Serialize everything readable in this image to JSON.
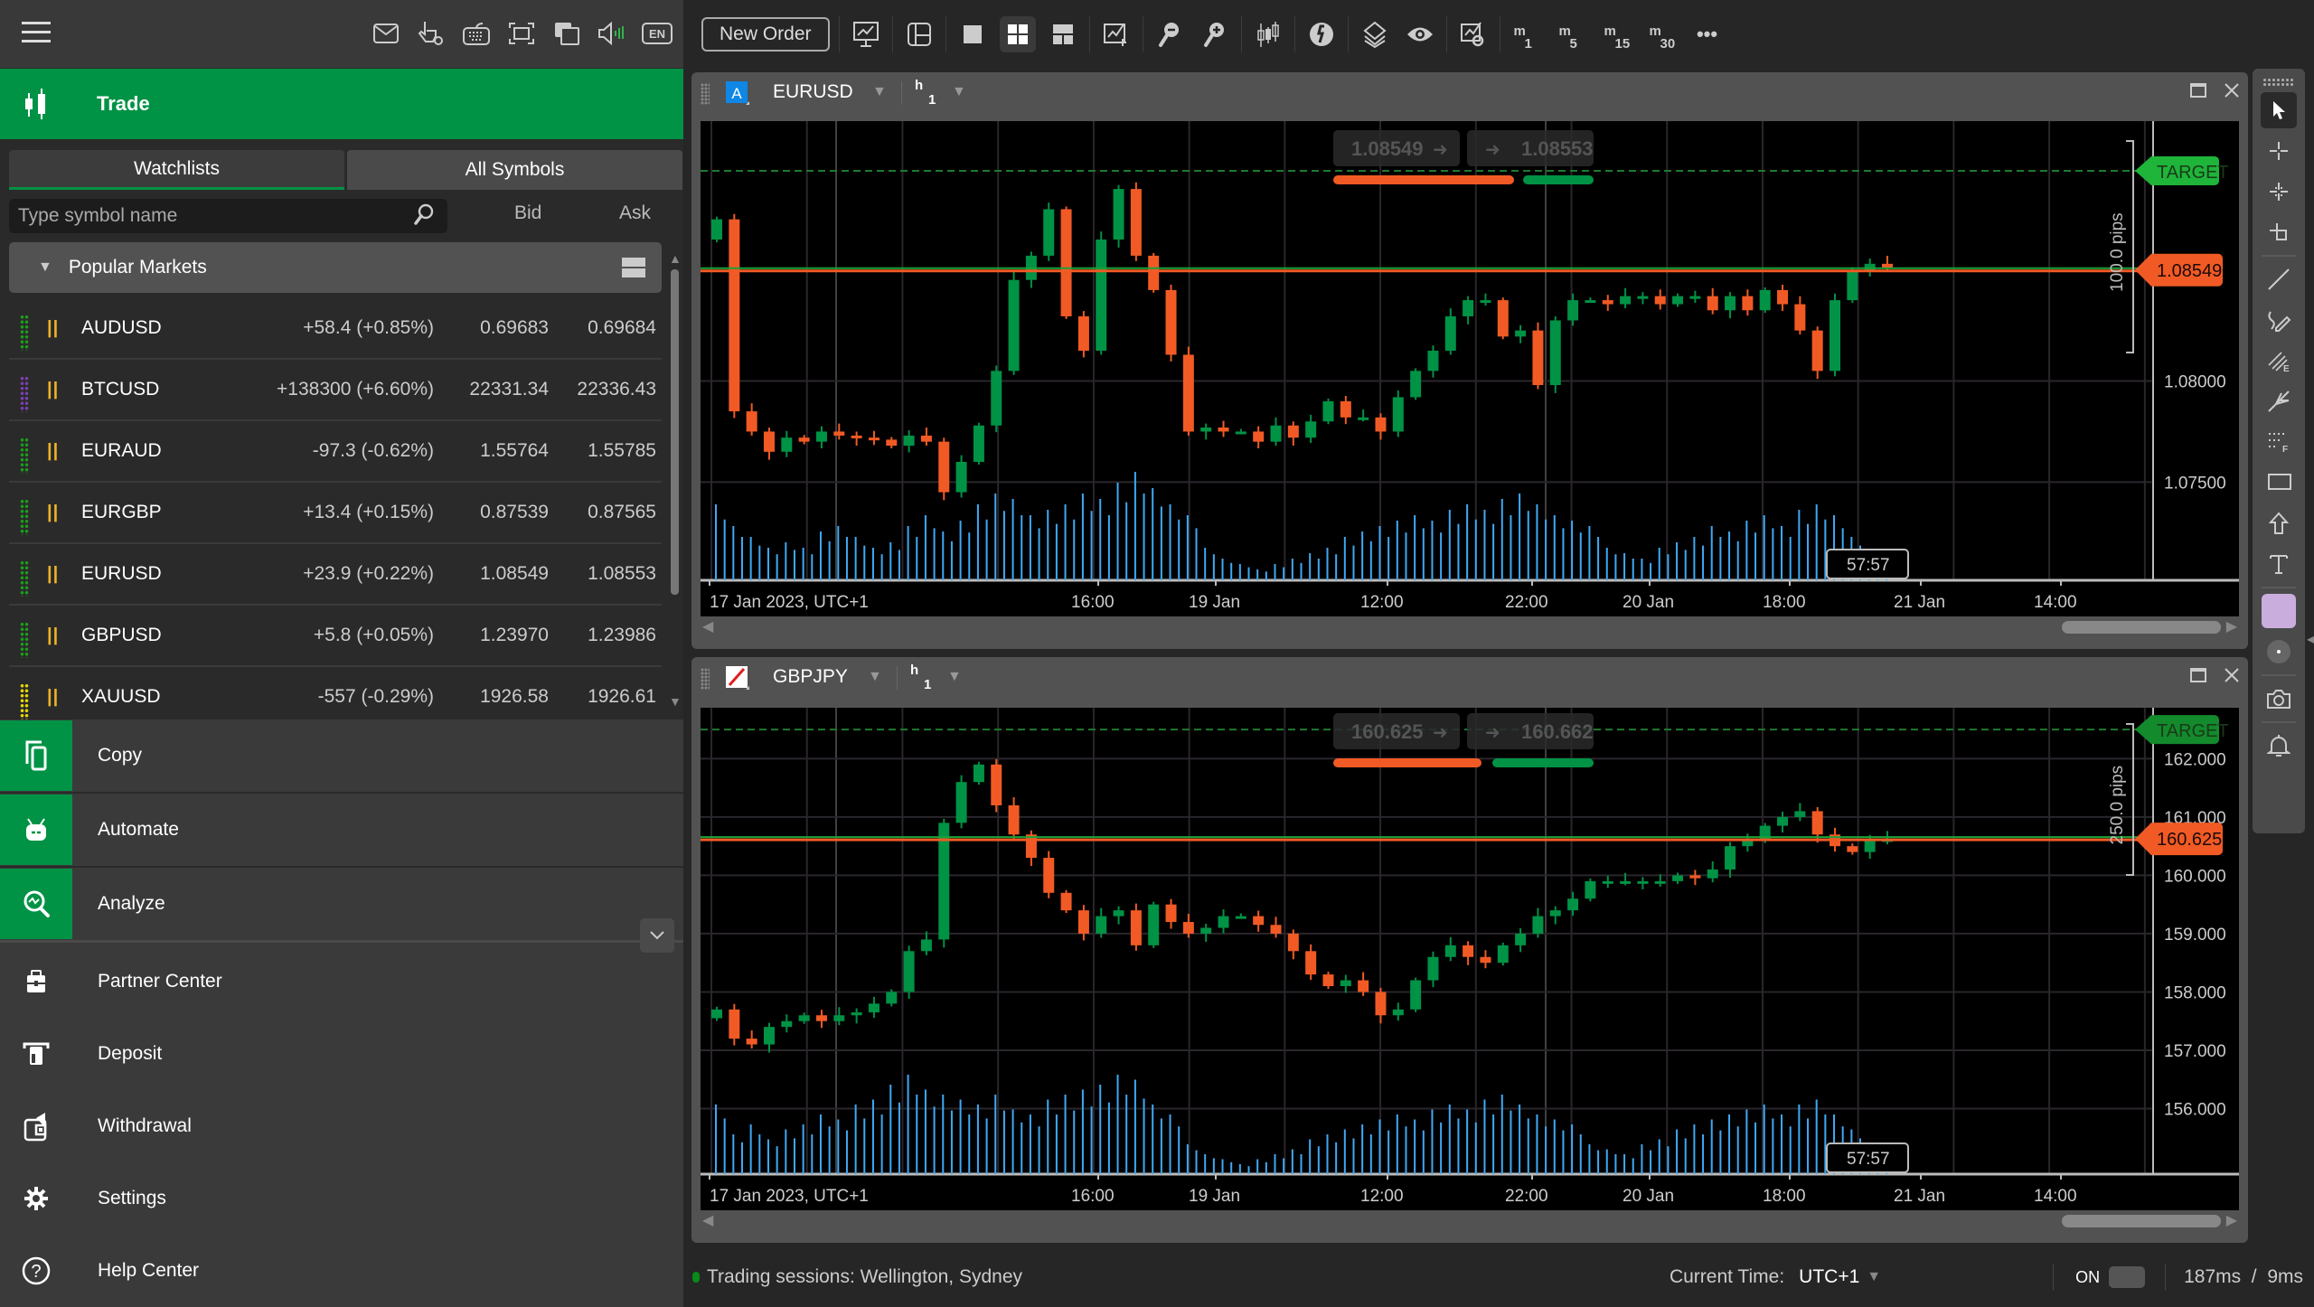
{
  "left_header": {
    "icons": [
      "mail-icon",
      "gesture-settings-icon",
      "keyboard-icon",
      "fullscreen-icon",
      "windows-icon",
      "sound-icon",
      "language-icon"
    ],
    "language": "EN"
  },
  "trade": {
    "label": "Trade"
  },
  "watch_tabs": [
    {
      "label": "Watchlists",
      "active": true
    },
    {
      "label": "All Symbols",
      "active": false
    }
  ],
  "search": {
    "placeholder": "Type symbol name",
    "value": ""
  },
  "columns": {
    "bid": "Bid",
    "ask": "Ask"
  },
  "group": {
    "label": "Popular Markets"
  },
  "symbols": [
    {
      "symbol": "AUDUSD",
      "change": "+58.4 (+0.85%)",
      "bid": "0.69683",
      "ask": "0.69684",
      "dot_color": "#1a9e1a"
    },
    {
      "symbol": "BTCUSD",
      "change": "+138300 (+6.60%)",
      "bid": "22331.34",
      "ask": "22336.43",
      "dot_color": "#7b3fb0"
    },
    {
      "symbol": "EURAUD",
      "change": "-97.3 (-0.62%)",
      "bid": "1.55764",
      "ask": "1.55785",
      "dot_color": "#1a9e1a"
    },
    {
      "symbol": "EURGBP",
      "change": "+13.4 (+0.15%)",
      "bid": "0.87539",
      "ask": "0.87565",
      "dot_color": "#1a9e1a"
    },
    {
      "symbol": "EURUSD",
      "change": "+23.9 (+0.22%)",
      "bid": "1.08549",
      "ask": "1.08553",
      "dot_color": "#1a9e1a"
    },
    {
      "symbol": "GBPUSD",
      "change": "+5.8 (+0.05%)",
      "bid": "1.23970",
      "ask": "1.23986",
      "dot_color": "#1a9e1a"
    },
    {
      "symbol": "XAUUSD",
      "change": "-557 (-0.29%)",
      "bid": "1926.58",
      "ask": "1926.61",
      "dot_color": "#e6d600"
    }
  ],
  "menu_green": [
    {
      "label": "Copy",
      "icon": "copy-icon"
    },
    {
      "label": "Automate",
      "icon": "robot-icon"
    },
    {
      "label": "Analyze",
      "icon": "analyze-icon"
    }
  ],
  "menu": [
    {
      "label": "Partner Center",
      "icon": "briefcase-icon"
    },
    {
      "label": "Deposit",
      "icon": "deposit-icon"
    },
    {
      "label": "Withdrawal",
      "icon": "wallet-icon"
    },
    {
      "label": "Settings",
      "icon": "gear-icon"
    },
    {
      "label": "Help Center",
      "icon": "help-icon"
    }
  ],
  "toolbar": {
    "new_order": "New Order",
    "timeframes": [
      {
        "t": "m",
        "n": "1"
      },
      {
        "t": "m",
        "n": "5"
      },
      {
        "t": "m",
        "n": "15"
      },
      {
        "t": "m",
        "n": "30"
      }
    ],
    "more": "•••"
  },
  "colors": {
    "bull": "#009245",
    "bear": "#f15a24",
    "volume": "#3fa9f5",
    "target": "#1eb53a",
    "accent": "#009245"
  },
  "chart_data": [
    {
      "type": "candlestick",
      "symbol": "EURUSD",
      "timeframe": {
        "t": "h",
        "n": "1"
      },
      "sell_price": "1.08549",
      "buy_price": "1.08553",
      "current_price_label": "1.08549",
      "current_price": 1.08549,
      "target_label": "TARGET",
      "target_price": 1.0904,
      "pips_label": "100.0 pips",
      "ylim": [
        1.0705,
        1.0925
      ],
      "y_ticks": [
        {
          "v": 1.08,
          "label": "1.08000"
        },
        {
          "v": 1.075,
          "label": "1.07500"
        }
      ],
      "x_ticks": [
        "17 Jan 2023, UTC+1",
        "16:00",
        "19 Jan",
        "12:00",
        "22:00",
        "20 Jan",
        "18:00",
        "21 Jan",
        "14:00"
      ],
      "countdown": "57:57",
      "closes": [
        1.088,
        1.0785,
        1.0775,
        1.0765,
        1.0772,
        1.077,
        1.0775,
        1.0773,
        1.0772,
        1.0771,
        1.0768,
        1.0773,
        1.077,
        1.0745,
        1.076,
        1.0778,
        1.0805,
        1.085,
        1.0862,
        1.0885,
        1.0832,
        1.0815,
        1.087,
        1.0895,
        1.0862,
        1.0845,
        1.0813,
        1.0775,
        1.0777,
        1.0775,
        1.0775,
        1.077,
        1.0778,
        1.0772,
        1.078,
        1.079,
        1.0782,
        1.0782,
        1.0775,
        1.0792,
        1.0805,
        1.0815,
        1.0832,
        1.084,
        1.084,
        1.0822,
        1.0825,
        1.0798,
        1.083,
        1.084,
        1.084,
        1.0838,
        1.0842,
        1.0842,
        1.0838,
        1.0842,
        1.0842,
        1.0835,
        1.0842,
        1.0835,
        1.0845,
        1.0838,
        1.0825,
        1.0805,
        1.084,
        1.0855,
        1.0858,
        1.0856
      ],
      "volumes": [
        0.7,
        0.5,
        0.4,
        0.3,
        0.35,
        0.3,
        0.45,
        0.5,
        0.4,
        0.3,
        0.35,
        0.5,
        0.6,
        0.45,
        0.55,
        0.7,
        0.8,
        0.75,
        0.6,
        0.65,
        0.7,
        0.8,
        0.75,
        0.9,
        1.0,
        0.85,
        0.7,
        0.6,
        0.3,
        0.2,
        0.15,
        0.1,
        0.15,
        0.2,
        0.25,
        0.3,
        0.4,
        0.45,
        0.5,
        0.55,
        0.6,
        0.55,
        0.65,
        0.7,
        0.65,
        0.75,
        0.8,
        0.7,
        0.6,
        0.55,
        0.5,
        0.3,
        0.25,
        0.2,
        0.3,
        0.35,
        0.4,
        0.5,
        0.45,
        0.55,
        0.6,
        0.5,
        0.65,
        0.7,
        0.6,
        0.4,
        0.25,
        0.15
      ]
    },
    {
      "type": "candlestick",
      "symbol": "GBPJPY",
      "timeframe": {
        "t": "h",
        "n": "1"
      },
      "sell_price": "160.625",
      "buy_price": "160.662",
      "current_price_label": "160.625",
      "current_price": 160.625,
      "target_label": "TARGET",
      "target_price": 162.5,
      "pips_label": "250.0 pips",
      "ylim": [
        155.0,
        162.75
      ],
      "y_ticks": [
        {
          "v": 162,
          "label": "162.000"
        },
        {
          "v": 161,
          "label": "161.000"
        },
        {
          "v": 160,
          "label": "160.000"
        },
        {
          "v": 159,
          "label": "159.000"
        },
        {
          "v": 158,
          "label": "158.000"
        },
        {
          "v": 157,
          "label": "157.000"
        },
        {
          "v": 156,
          "label": "156.000"
        }
      ],
      "x_ticks": [
        "17 Jan 2023, UTC+1",
        "16:00",
        "19 Jan",
        "12:00",
        "22:00",
        "20 Jan",
        "18:00",
        "21 Jan",
        "14:00"
      ],
      "countdown": "57:57",
      "closes": [
        157.7,
        157.2,
        157.1,
        157.4,
        157.5,
        157.6,
        157.5,
        157.6,
        157.65,
        157.8,
        158.0,
        158.7,
        158.9,
        160.9,
        161.6,
        161.9,
        161.2,
        160.7,
        160.3,
        159.7,
        159.4,
        159.0,
        159.3,
        159.4,
        158.8,
        159.5,
        159.2,
        159.0,
        159.1,
        159.3,
        159.3,
        159.15,
        159.0,
        158.7,
        158.3,
        158.1,
        158.2,
        158.0,
        157.6,
        157.7,
        158.2,
        158.6,
        158.8,
        158.6,
        158.5,
        158.8,
        159.0,
        159.3,
        159.4,
        159.6,
        159.9,
        159.9,
        159.9,
        159.9,
        159.9,
        160.0,
        159.95,
        160.1,
        160.5,
        160.6,
        160.85,
        161.0,
        161.1,
        160.7,
        160.5,
        160.4,
        160.6,
        160.62
      ],
      "volumes": [
        0.7,
        0.4,
        0.5,
        0.35,
        0.45,
        0.5,
        0.6,
        0.55,
        0.7,
        0.75,
        0.9,
        1.0,
        0.85,
        0.8,
        0.75,
        0.7,
        0.8,
        0.65,
        0.6,
        0.75,
        0.8,
        0.85,
        0.9,
        1.0,
        0.95,
        0.7,
        0.6,
        0.3,
        0.2,
        0.15,
        0.1,
        0.15,
        0.2,
        0.25,
        0.35,
        0.4,
        0.45,
        0.5,
        0.55,
        0.6,
        0.55,
        0.65,
        0.7,
        0.65,
        0.75,
        0.8,
        0.7,
        0.6,
        0.55,
        0.5,
        0.3,
        0.25,
        0.2,
        0.3,
        0.35,
        0.45,
        0.5,
        0.55,
        0.6,
        0.65,
        0.7,
        0.6,
        0.7,
        0.75,
        0.6,
        0.45,
        0.3,
        0.2
      ]
    }
  ],
  "status": {
    "sessions": "Trading sessions: Wellington, Sydney",
    "current_time_label": "Current Time:",
    "timezone": "UTC+1",
    "toggle_label": "ON",
    "latency": "187ms  /  9ms"
  }
}
